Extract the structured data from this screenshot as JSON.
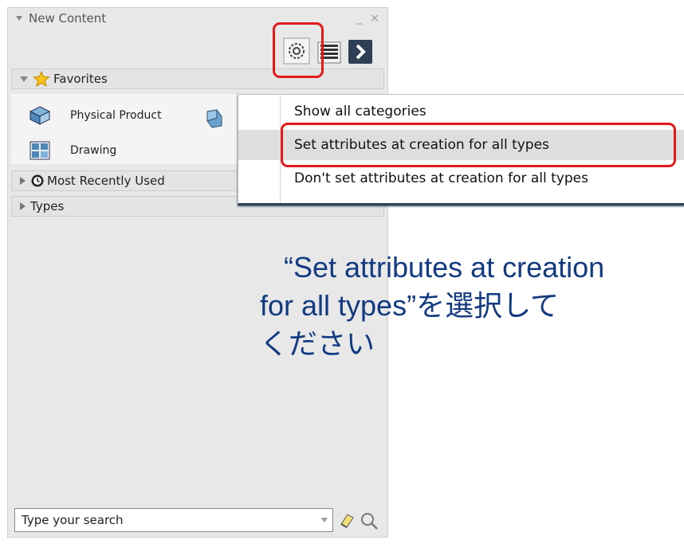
{
  "panel": {
    "title": "New Content",
    "minimize_label": "_",
    "close_label": "×",
    "toolbar": {
      "settings_icon": "gear-icon",
      "list_icon": "list-icon",
      "expand_icon": "chevron-right-icon"
    },
    "sections": {
      "favorites": {
        "label": "Favorites",
        "items": [
          {
            "label": "Physical Product",
            "icon": "physical-product-icon"
          },
          {
            "label": "Drawing",
            "icon": "drawing-icon"
          }
        ]
      },
      "most_recent": {
        "label": "Most Recently Used"
      },
      "types": {
        "label": "Types"
      }
    },
    "search": {
      "placeholder": "Type your search"
    }
  },
  "context_menu": {
    "items": [
      {
        "label": "Show all categories"
      },
      {
        "label": "Set attributes at creation for all types"
      },
      {
        "label": "Don't set attributes at creation for all types"
      }
    ]
  },
  "instruction": {
    "line1": "“Set attributes at creation",
    "line2": "for all types”を選択して",
    "line3": "ください"
  },
  "colors": {
    "highlight": "#e21a1a",
    "caption": "#123a80",
    "accent": "#2d3e55"
  }
}
